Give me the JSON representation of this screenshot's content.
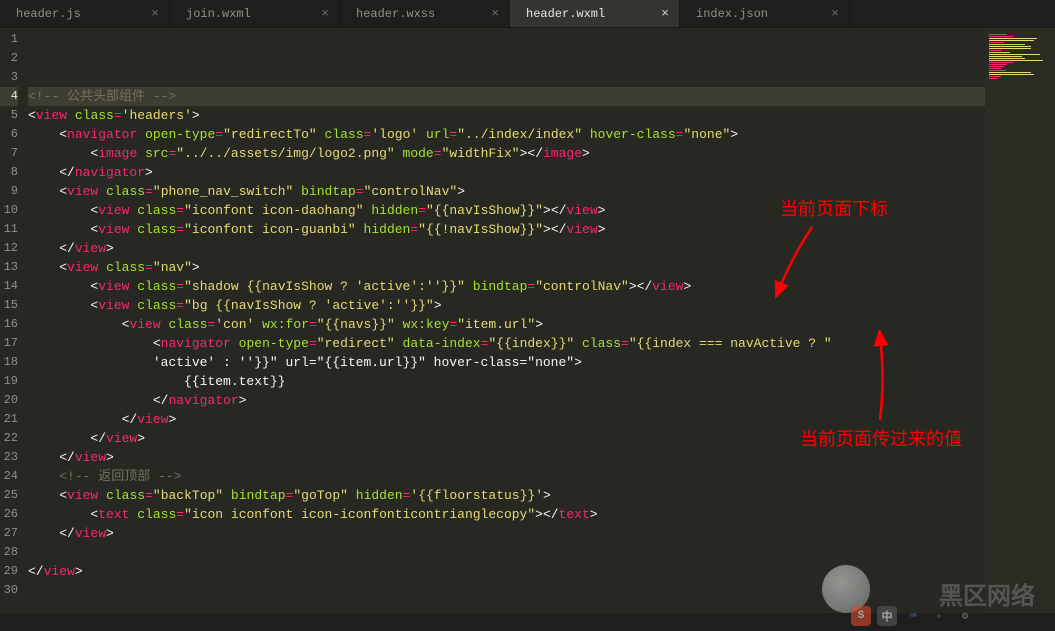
{
  "tabs": [
    {
      "label": "header.js",
      "active": false
    },
    {
      "label": "join.wxml",
      "active": false
    },
    {
      "label": "header.wxss",
      "active": false
    },
    {
      "label": "header.wxml",
      "active": true
    },
    {
      "label": "index.json",
      "active": false
    }
  ],
  "line_start": 1,
  "line_end": 30,
  "highlight_line": 4,
  "code_lines": [
    "",
    "",
    "",
    "<!-- 公共头部组件 -->",
    "<view class='headers'>",
    "    <navigator open-type=\"redirectTo\" class='logo' url=\"../index/index\" hover-class=\"none\">",
    "        <image src=\"../../assets/img/logo2.png\" mode=\"widthFix\"></image>",
    "    </navigator>",
    "    <view class=\"phone_nav_switch\" bindtap=\"controlNav\">",
    "        <view class=\"iconfont icon-daohang\" hidden=\"{{navIsShow}}\"></view>",
    "        <view class=\"iconfont icon-guanbi\" hidden=\"{{!navIsShow}}\"></view>",
    "    </view>",
    "    <view class=\"nav\">",
    "        <view class=\"shadow {{navIsShow ? 'active':''}}\" bindtap=\"controlNav\"></view>",
    "        <view class=\"bg {{navIsShow ? 'active':''}}\">",
    "            <view class='con' wx:for=\"{{navs}}\" wx:key=\"item.url\">",
    "                <navigator open-type=\"redirect\" data-index=\"{{index}}\" class=\"{{index === navActive ? 'active' : ''}}\" url=\"{{item.url}}\" hover-class=\"none\">",
    "                    {{item.text}}",
    "                </navigator>",
    "            </view>",
    "        </view>",
    "    </view>",
    "    <!-- 返回顶部 -->",
    "    <view class=\"backTop\" bindtap=\"goTop\" hidden='{{floorstatus}}'>",
    "        <text class=\"icon iconfont icon-iconfonticontrianglecopy\"></text>",
    "    </view>",
    "",
    "</view>",
    "",
    ""
  ],
  "annotations": {
    "anno1": "当前页面下标",
    "anno2": "当前页面传过来的值"
  },
  "watermark": "黑区网络",
  "ime_letter": "中"
}
